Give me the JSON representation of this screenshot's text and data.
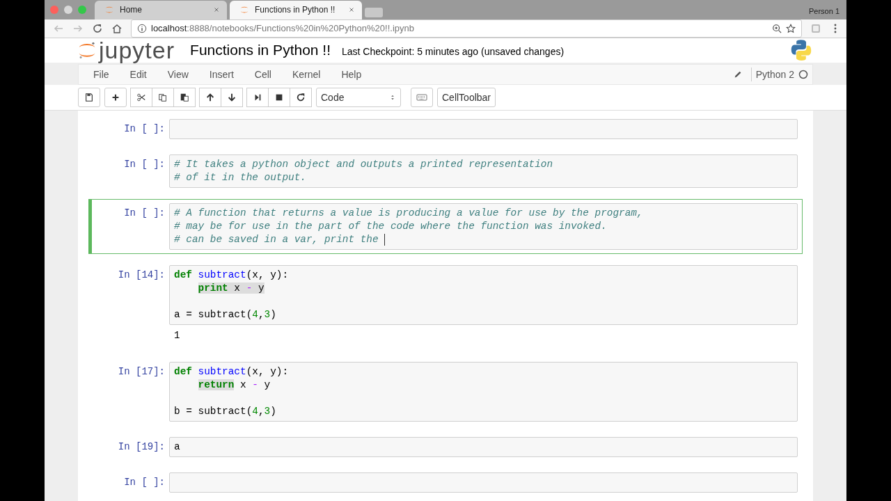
{
  "browser": {
    "tabs": [
      {
        "label": "Home",
        "selected": false
      },
      {
        "label": "Functions in Python !!",
        "selected": true
      }
    ],
    "profile": "Person 1",
    "url": {
      "host": "localhost",
      "rest": ":8888/notebooks/Functions%20in%20Python%20!!.ipynb"
    }
  },
  "header": {
    "logo_text": "jupyter",
    "notebook_title": "Functions in Python !!",
    "checkpoint": "Last Checkpoint: 5 minutes ago (unsaved changes)"
  },
  "menu": {
    "items": [
      "File",
      "Edit",
      "View",
      "Insert",
      "Cell",
      "Kernel",
      "Help"
    ],
    "kernel_name": "Python 2",
    "kernel_busy": false
  },
  "toolbar": {
    "cell_type": "Code",
    "celltoolbar": "CellToolbar"
  },
  "cells": [
    {
      "prompt": "In [ ]:",
      "selected": false
    },
    {
      "prompt": "In [ ]:",
      "selected": false,
      "lines": [
        {
          "kind": "code",
          "indented": false,
          "tokens": [
            {
              "kind": "comment",
              "text": "# It takes a python object and outputs a printed representation"
            }
          ]
        },
        {
          "kind": "code",
          "indented": false,
          "tokens": [
            {
              "kind": "comment",
              "text": "# of it in the output."
            }
          ]
        }
      ]
    },
    {
      "prompt": "In [ ]:",
      "selected": true,
      "lines": [
        {
          "kind": "code",
          "indented": false,
          "tokens": [
            {
              "kind": "comment",
              "text": "# A function that returns a value is producing a value for use by the program,"
            }
          ]
        },
        {
          "kind": "code",
          "indented": false,
          "tokens": [
            {
              "kind": "comment",
              "text": "# may be for use in the part of the code where the function was invoked."
            }
          ]
        },
        {
          "kind": "code",
          "indented": false,
          "tokens": [
            {
              "kind": "comment",
              "text": "# can be saved in a var, print the"
            }
          ]
        }
      ]
    },
    {
      "prompt": "In [14]:",
      "selected": false,
      "output": "1",
      "lines": [
        {
          "kind": "code",
          "indented": false,
          "tokens": [
            {
              "kind": "keyword",
              "text": "def"
            },
            {
              "kind": "function",
              "text": " subtract"
            },
            {
              "kind": "text",
              "text": "(x, y):"
            }
          ]
        },
        {
          "kind": "code",
          "indented": true,
          "tokens": [
            {
              "kind": "match",
              "tokens": [
                {
                  "kind": "keyword",
                  "text": "print"
                },
                {
                  "kind": "text",
                  "text": " x "
                },
                {
                  "kind": "operator",
                  "text": "-"
                },
                {
                  "kind": "text",
                  "text": " y"
                }
              ]
            }
          ]
        },
        {
          "kind": "blank"
        },
        {
          "kind": "code",
          "indented": false,
          "tokens": [
            {
              "kind": "text",
              "text": "a = subtract("
            },
            {
              "kind": "number",
              "text": "4"
            },
            {
              "kind": "text",
              "text": ","
            },
            {
              "kind": "number",
              "text": "3"
            },
            {
              "kind": "text",
              "text": ")"
            }
          ]
        }
      ]
    },
    {
      "prompt": "In [17]:",
      "selected": false,
      "lines": [
        {
          "kind": "code",
          "indented": false,
          "tokens": [
            {
              "kind": "keyword",
              "text": "def"
            },
            {
              "kind": "function",
              "text": " subtract"
            },
            {
              "kind": "text",
              "text": "(x, y):"
            }
          ]
        },
        {
          "kind": "code",
          "indented": true,
          "tokens": [
            {
              "kind": "match",
              "tokens": [
                {
                  "kind": "keyword",
                  "text": "return"
                }
              ]
            },
            {
              "kind": "text",
              "text": " x "
            },
            {
              "kind": "operator",
              "text": "-"
            },
            {
              "kind": "text",
              "text": " y"
            }
          ]
        },
        {
          "kind": "blank"
        },
        {
          "kind": "code",
          "indented": false,
          "tokens": [
            {
              "kind": "text",
              "text": "b = subtract("
            },
            {
              "kind": "number",
              "text": "4"
            },
            {
              "kind": "text",
              "text": ","
            },
            {
              "kind": "number",
              "text": "3"
            },
            {
              "kind": "text",
              "text": ")"
            }
          ]
        }
      ]
    },
    {
      "prompt": "In [19]:",
      "selected": false,
      "lines": [
        {
          "kind": "code",
          "indented": false,
          "tokens": [
            {
              "kind": "text",
              "text": "a"
            }
          ]
        }
      ]
    },
    {
      "prompt": "In [ ]:",
      "selected": false
    }
  ]
}
